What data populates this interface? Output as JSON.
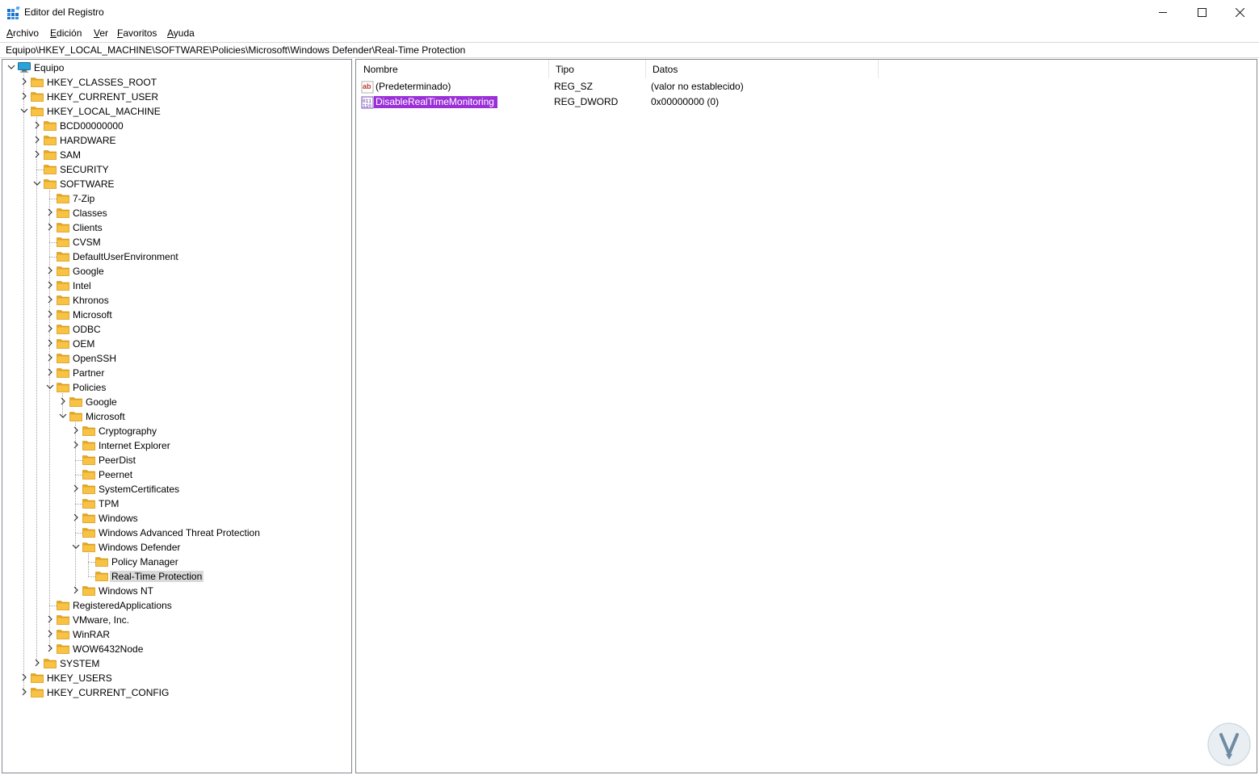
{
  "window": {
    "title": "Editor del Registro",
    "controls": {
      "minimize": "minimize-icon",
      "maximize": "maximize-icon",
      "close": "close-icon"
    }
  },
  "menu": [
    "Archivo",
    "Edición",
    "Ver",
    "Favoritos",
    "Ayuda"
  ],
  "address": "Equipo\\HKEY_LOCAL_MACHINE\\SOFTWARE\\Policies\\Microsoft\\Windows Defender\\Real-Time Protection",
  "tree": [
    {
      "label": "Equipo",
      "level": 0,
      "type": "computer",
      "expanded": true
    },
    {
      "label": "HKEY_CLASSES_ROOT",
      "level": 1,
      "chevron": "right"
    },
    {
      "label": "HKEY_CURRENT_USER",
      "level": 1,
      "chevron": "right"
    },
    {
      "label": "HKEY_LOCAL_MACHINE",
      "level": 1,
      "chevron": "down"
    },
    {
      "label": "BCD00000000",
      "level": 2,
      "chevron": "right"
    },
    {
      "label": "HARDWARE",
      "level": 2,
      "chevron": "right"
    },
    {
      "label": "SAM",
      "level": 2,
      "chevron": "right"
    },
    {
      "label": "SECURITY",
      "level": 2,
      "chevron": "none"
    },
    {
      "label": "SOFTWARE",
      "level": 2,
      "chevron": "down"
    },
    {
      "label": "7-Zip",
      "level": 3,
      "chevron": "none"
    },
    {
      "label": "Classes",
      "level": 3,
      "chevron": "right"
    },
    {
      "label": "Clients",
      "level": 3,
      "chevron": "right"
    },
    {
      "label": "CVSM",
      "level": 3,
      "chevron": "none"
    },
    {
      "label": "DefaultUserEnvironment",
      "level": 3,
      "chevron": "none"
    },
    {
      "label": "Google",
      "level": 3,
      "chevron": "right"
    },
    {
      "label": "Intel",
      "level": 3,
      "chevron": "right"
    },
    {
      "label": "Khronos",
      "level": 3,
      "chevron": "right"
    },
    {
      "label": "Microsoft",
      "level": 3,
      "chevron": "right"
    },
    {
      "label": "ODBC",
      "level": 3,
      "chevron": "right"
    },
    {
      "label": "OEM",
      "level": 3,
      "chevron": "right"
    },
    {
      "label": "OpenSSH",
      "level": 3,
      "chevron": "right"
    },
    {
      "label": "Partner",
      "level": 3,
      "chevron": "right"
    },
    {
      "label": "Policies",
      "level": 3,
      "chevron": "down"
    },
    {
      "label": "Google",
      "level": 4,
      "chevron": "right"
    },
    {
      "label": "Microsoft",
      "level": 4,
      "chevron": "down"
    },
    {
      "label": "Cryptography",
      "level": 5,
      "chevron": "right"
    },
    {
      "label": "Internet Explorer",
      "level": 5,
      "chevron": "right"
    },
    {
      "label": "PeerDist",
      "level": 5,
      "chevron": "none"
    },
    {
      "label": "Peernet",
      "level": 5,
      "chevron": "none"
    },
    {
      "label": "SystemCertificates",
      "level": 5,
      "chevron": "right"
    },
    {
      "label": "TPM",
      "level": 5,
      "chevron": "none"
    },
    {
      "label": "Windows",
      "level": 5,
      "chevron": "right"
    },
    {
      "label": "Windows Advanced Threat Protection",
      "level": 5,
      "chevron": "none"
    },
    {
      "label": "Windows Defender",
      "level": 5,
      "chevron": "down"
    },
    {
      "label": "Policy Manager",
      "level": 6,
      "chevron": "none"
    },
    {
      "label": "Real-Time Protection",
      "level": 6,
      "chevron": "none",
      "selected": true
    },
    {
      "label": "Windows NT",
      "level": 5,
      "chevron": "right"
    },
    {
      "label": "RegisteredApplications",
      "level": 3,
      "chevron": "none"
    },
    {
      "label": "VMware, Inc.",
      "level": 3,
      "chevron": "right"
    },
    {
      "label": "WinRAR",
      "level": 3,
      "chevron": "right"
    },
    {
      "label": "WOW6432Node",
      "level": 3,
      "chevron": "right"
    },
    {
      "label": "SYSTEM",
      "level": 2,
      "chevron": "right"
    },
    {
      "label": "HKEY_USERS",
      "level": 1,
      "chevron": "right"
    },
    {
      "label": "HKEY_CURRENT_CONFIG",
      "level": 1,
      "chevron": "right"
    }
  ],
  "list": {
    "columns": [
      "Nombre",
      "Tipo",
      "Datos"
    ],
    "rows": [
      {
        "icon": "string-value-icon",
        "name": "(Predeterminado)",
        "type": "REG_SZ",
        "data": "(valor no establecido)",
        "selected": false
      },
      {
        "icon": "dword-value-icon",
        "name": "DisableRealTimeMonitoring",
        "type": "REG_DWORD",
        "data": "0x00000000 (0)",
        "selected": true
      }
    ]
  },
  "colors": {
    "selection": "#9b30d8",
    "tree_selection": "#d9d9d9",
    "folder": "#f8c245"
  }
}
